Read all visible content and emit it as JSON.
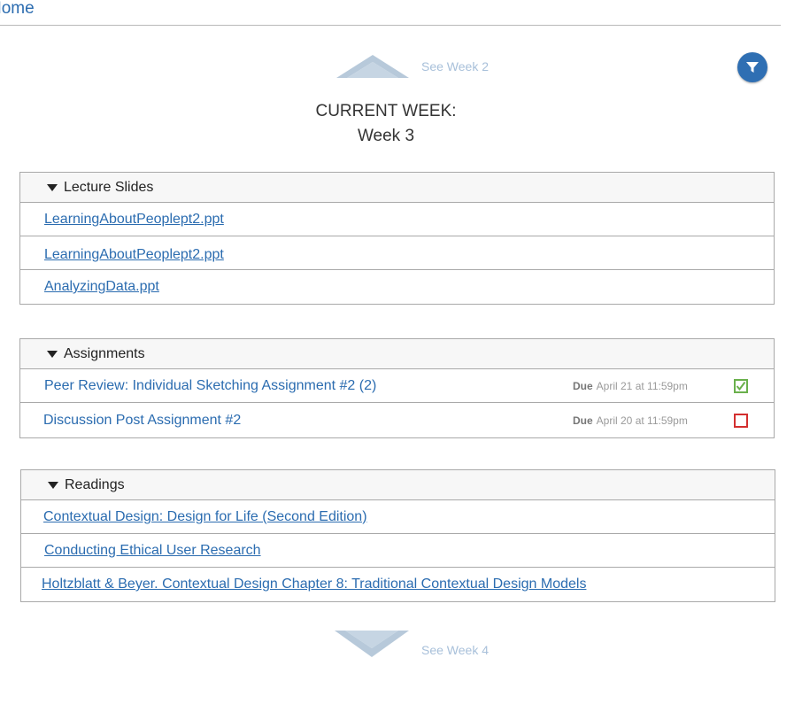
{
  "nav": {
    "home_label": "Home",
    "prev_week_label": "See Week 2",
    "next_week_label": "See Week 4"
  },
  "current_week": {
    "heading": "CURRENT WEEK:",
    "name": "Week 3"
  },
  "lecture_slides": {
    "title": "Lecture Slides",
    "items": [
      "LearningAboutPeoplept2.ppt",
      "LearningAboutPeoplept2.ppt",
      "AnalyzingData.ppt"
    ]
  },
  "assignments": {
    "title": "Assignments",
    "items": [
      {
        "label": "Peer Review: Individual Sketching Assignment #2 (2)",
        "due_prefix": "Due",
        "due_text": "April  21 at 11:59pm",
        "completed": true
      },
      {
        "label": "Discussion Post Assignment #2",
        "due_prefix": "Due",
        "due_text": "April 20 at 11:59pm",
        "completed": false
      }
    ]
  },
  "readings": {
    "title": "Readings",
    "items": [
      "Contextual Design: Design for Life (Second Edition)",
      "Conducting Ethical User Research",
      "Holtzblatt & Beyer. Contextual Design Chapter 8: Traditional Contextual Design Models"
    ]
  },
  "icons": {
    "filter": "filter-icon",
    "prev": "chevron-up-icon",
    "next": "chevron-down-icon",
    "expand": "triangle-down-icon",
    "done": "checkbox-checked-icon",
    "todo": "checkbox-empty-icon"
  },
  "colors": {
    "link": "#2b6cb0",
    "filter_button": "#2f6fb3",
    "chevron": "#b7c9da",
    "nav_label": "#a8c0da",
    "check_done": "#6ab04c",
    "check_todo": "#d32f2f"
  }
}
